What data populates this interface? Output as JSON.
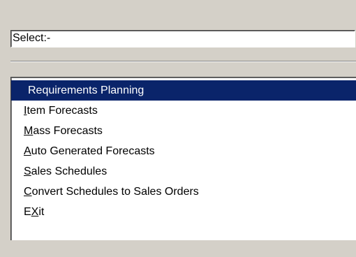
{
  "select_field": {
    "value": "Select:-"
  },
  "menu": {
    "items": [
      {
        "label": "Requirements Planning",
        "mnemonic_prefix": "",
        "mnemonic": "",
        "mnemonic_suffix": "Requirements Planning",
        "selected": true
      },
      {
        "label": "Item Forecasts",
        "mnemonic_prefix": "",
        "mnemonic": "I",
        "mnemonic_suffix": "tem Forecasts",
        "selected": false
      },
      {
        "label": "Mass Forecasts",
        "mnemonic_prefix": "",
        "mnemonic": "M",
        "mnemonic_suffix": "ass Forecasts",
        "selected": false
      },
      {
        "label": "Auto Generated Forecasts",
        "mnemonic_prefix": "",
        "mnemonic": "A",
        "mnemonic_suffix": "uto Generated Forecasts",
        "selected": false
      },
      {
        "label": "Sales Schedules",
        "mnemonic_prefix": "",
        "mnemonic": "S",
        "mnemonic_suffix": "ales Schedules",
        "selected": false
      },
      {
        "label": "Convert Schedules to Sales Orders",
        "mnemonic_prefix": "",
        "mnemonic": "C",
        "mnemonic_suffix": "onvert Schedules to Sales Orders",
        "selected": false
      },
      {
        "label": "EXit",
        "mnemonic_prefix": "E",
        "mnemonic": "X",
        "mnemonic_suffix": "it",
        "selected": false
      }
    ]
  },
  "colors": {
    "window_background": "#d4d0c8",
    "selection_background": "#0a246a",
    "selection_text": "#ffffff"
  }
}
